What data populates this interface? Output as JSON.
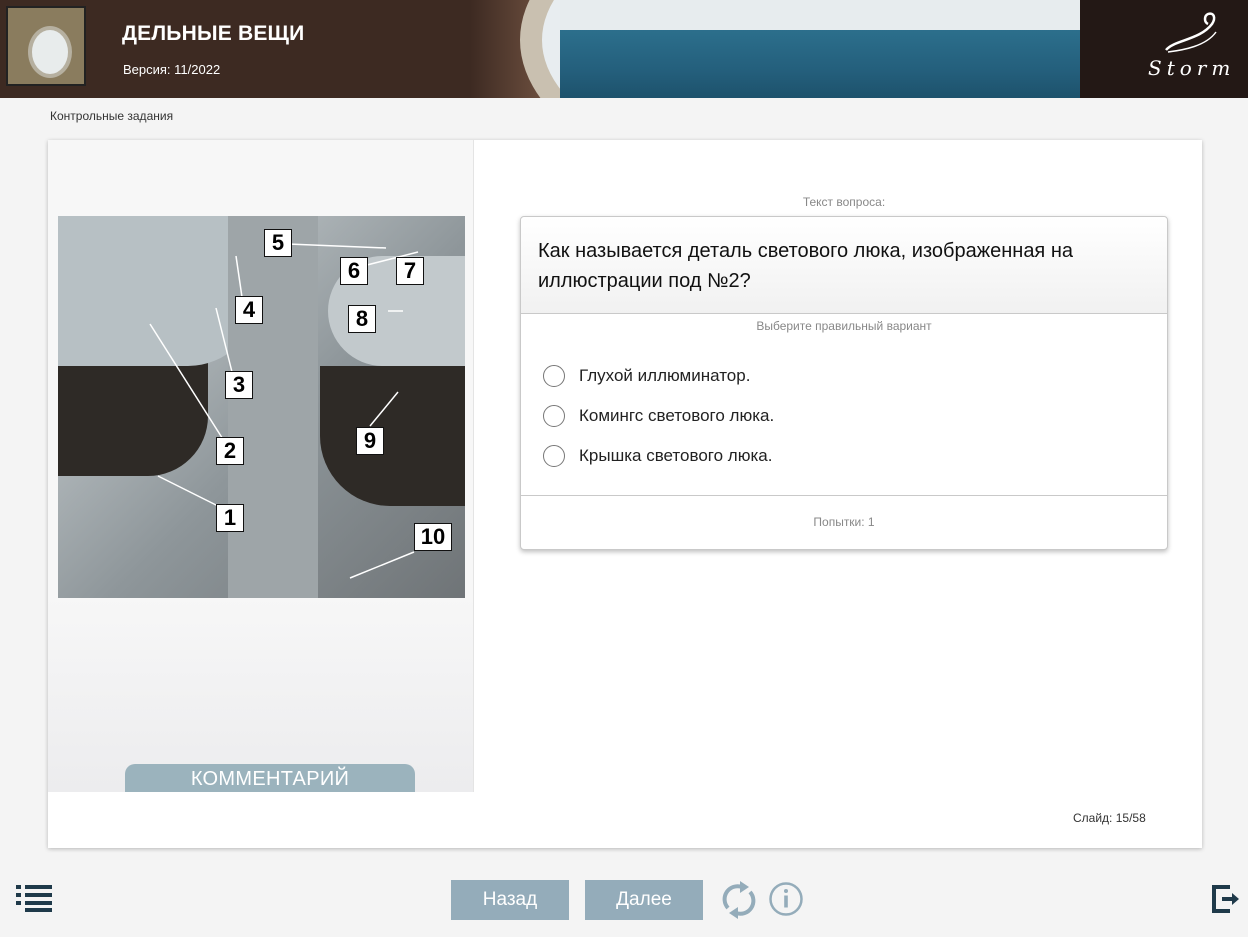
{
  "header": {
    "title": "ДЕЛЬНЫЕ ВЕЩИ",
    "version": "Версия: 11/2022",
    "brand": "Storm"
  },
  "breadcrumb": "Контрольные задания",
  "figure": {
    "labels": [
      "1",
      "2",
      "3",
      "4",
      "5",
      "6",
      "7",
      "8",
      "9",
      "10"
    ]
  },
  "comment_button": "КОММЕНТАРИЙ",
  "question": {
    "label": "Текст вопроса:",
    "text": "Как называется деталь светового люка, изображенная на иллюстрации под №2?",
    "hint": "Выберите правильный вариант",
    "options": [
      {
        "label": "Глухой иллюминатор."
      },
      {
        "label": "Комингс светового люка."
      },
      {
        "label": "Крышка светового люка."
      }
    ],
    "attempts": "Попытки: 1"
  },
  "slide_info": "Слайд:  15/58",
  "nav": {
    "back": "Назад",
    "next": "Далее"
  },
  "colors": {
    "header_bg": "#3d2a22",
    "button_bg": "#94acba",
    "comment_bg": "#9bb3bd"
  },
  "icons": [
    "menu-icon",
    "reload-icon",
    "info-icon",
    "exit-icon"
  ]
}
